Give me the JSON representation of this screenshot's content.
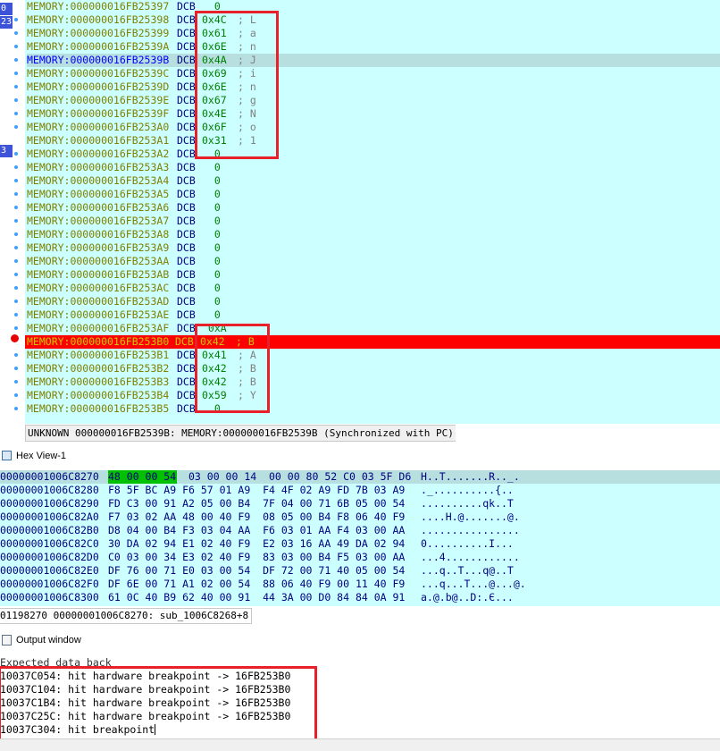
{
  "disassembly": {
    "gutter_tags": [
      "0",
      "23",
      "3"
    ],
    "rows": [
      {
        "addr": "MEMORY:000000016FB25397",
        "ins": "DCB",
        "val": "  0",
        "cmt": ""
      },
      {
        "addr": "MEMORY:000000016FB25398",
        "ins": "DCB",
        "val": "0x4C",
        "cmt": "; L"
      },
      {
        "addr": "MEMORY:000000016FB25399",
        "ins": "DCB",
        "val": "0x61",
        "cmt": "; a"
      },
      {
        "addr": "MEMORY:000000016FB2539A",
        "ins": "DCB",
        "val": "0x6E",
        "cmt": "; n"
      },
      {
        "addr": "MEMORY:000000016FB2539B",
        "ins": "DCB",
        "val": "0x4A",
        "cmt": "; J"
      },
      {
        "addr": "MEMORY:000000016FB2539C",
        "ins": "DCB",
        "val": "0x69",
        "cmt": "; i"
      },
      {
        "addr": "MEMORY:000000016FB2539D",
        "ins": "DCB",
        "val": "0x6E",
        "cmt": "; n"
      },
      {
        "addr": "MEMORY:000000016FB2539E",
        "ins": "DCB",
        "val": "0x67",
        "cmt": "; g"
      },
      {
        "addr": "MEMORY:000000016FB2539F",
        "ins": "DCB",
        "val": "0x4E",
        "cmt": "; N"
      },
      {
        "addr": "MEMORY:000000016FB253A0",
        "ins": "DCB",
        "val": "0x6F",
        "cmt": "; o"
      },
      {
        "addr": "MEMORY:000000016FB253A1",
        "ins": "DCB",
        "val": "0x31",
        "cmt": "; 1"
      },
      {
        "addr": "MEMORY:000000016FB253A2",
        "ins": "DCB",
        "val": "  0",
        "cmt": ""
      },
      {
        "addr": "MEMORY:000000016FB253A3",
        "ins": "DCB",
        "val": "  0",
        "cmt": ""
      },
      {
        "addr": "MEMORY:000000016FB253A4",
        "ins": "DCB",
        "val": "  0",
        "cmt": ""
      },
      {
        "addr": "MEMORY:000000016FB253A5",
        "ins": "DCB",
        "val": "  0",
        "cmt": ""
      },
      {
        "addr": "MEMORY:000000016FB253A6",
        "ins": "DCB",
        "val": "  0",
        "cmt": ""
      },
      {
        "addr": "MEMORY:000000016FB253A7",
        "ins": "DCB",
        "val": "  0",
        "cmt": ""
      },
      {
        "addr": "MEMORY:000000016FB253A8",
        "ins": "DCB",
        "val": "  0",
        "cmt": ""
      },
      {
        "addr": "MEMORY:000000016FB253A9",
        "ins": "DCB",
        "val": "  0",
        "cmt": ""
      },
      {
        "addr": "MEMORY:000000016FB253AA",
        "ins": "DCB",
        "val": "  0",
        "cmt": ""
      },
      {
        "addr": "MEMORY:000000016FB253AB",
        "ins": "DCB",
        "val": "  0",
        "cmt": ""
      },
      {
        "addr": "MEMORY:000000016FB253AC",
        "ins": "DCB",
        "val": "  0",
        "cmt": ""
      },
      {
        "addr": "MEMORY:000000016FB253AD",
        "ins": "DCB",
        "val": "  0",
        "cmt": ""
      },
      {
        "addr": "MEMORY:000000016FB253AE",
        "ins": "DCB",
        "val": "  0",
        "cmt": ""
      },
      {
        "addr": "MEMORY:000000016FB253AF",
        "ins": "DCB",
        "val": " 0xA",
        "cmt": ""
      },
      {
        "addr": "MEMORY:000000016FB253B0",
        "ins": "DCB",
        "val": "0x42",
        "cmt": "; B"
      },
      {
        "addr": "MEMORY:000000016FB253B1",
        "ins": "DCB",
        "val": "0x41",
        "cmt": "; A"
      },
      {
        "addr": "MEMORY:000000016FB253B2",
        "ins": "DCB",
        "val": "0x42",
        "cmt": "; B"
      },
      {
        "addr": "MEMORY:000000016FB253B3",
        "ins": "DCB",
        "val": "0x42",
        "cmt": "; B"
      },
      {
        "addr": "MEMORY:000000016FB253B4",
        "ins": "DCB",
        "val": "0x59",
        "cmt": "; Y"
      },
      {
        "addr": "MEMORY:000000016FB253B5",
        "ins": "DCB",
        "val": "  0",
        "cmt": ""
      }
    ],
    "status": "UNKNOWN 000000016FB2539B: MEMORY:000000016FB2539B (Synchronized with PC)"
  },
  "hex_view": {
    "title": "Hex View-1",
    "rows": [
      {
        "addr": "00000001006C8270",
        "bytes": "48 00 00 54  03 00 00 14  00 00 80 52 C0 03 5F D6",
        "ascii": "H..T.......R.._."
      },
      {
        "addr": "00000001006C8280",
        "bytes": "F8 5F BC A9 F6 57 01 A9  F4 4F 02 A9 FD 7B 03 A9",
        "ascii": "._..........{.."
      },
      {
        "addr": "00000001006C8290",
        "bytes": "FD C3 00 91 A2 05 00 B4  7F 04 00 71 6B 05 00 54",
        "ascii": "..........qk..T"
      },
      {
        "addr": "00000001006C82A0",
        "bytes": "F7 03 02 AA 48 00 40 F9  08 05 00 B4 F8 06 40 F9",
        "ascii": "....H.@.......@."
      },
      {
        "addr": "00000001006C82B0",
        "bytes": "D8 04 00 B4 F3 03 04 AA  F6 03 01 AA F4 03 00 AA",
        "ascii": "................"
      },
      {
        "addr": "00000001006C82C0",
        "bytes": "30 DA 02 94 E1 02 40 F9  E2 03 16 AA 49 DA 02 94",
        "ascii": "0..........I..."
      },
      {
        "addr": "00000001006C82D0",
        "bytes": "C0 03 00 34 E3 02 40 F9  83 03 00 B4 F5 03 00 AA",
        "ascii": "...4............"
      },
      {
        "addr": "00000001006C82E0",
        "bytes": "DF 76 00 71 E0 03 00 54  DF 72 00 71 40 05 00 54",
        "ascii": "...q..T...q@..T"
      },
      {
        "addr": "00000001006C82F0",
        "bytes": "DF 6E 00 71 A1 02 00 54  88 06 40 F9 00 11 40 F9",
        "ascii": "...q...T...@...@."
      },
      {
        "addr": "00000001006C8300",
        "bytes": "61 0C 40 B9 62 40 00 91  44 3A 00 D0 84 84 0A 91",
        "ascii": "a.@.b@..D:.Є..."
      }
    ],
    "status": "01198270 00000001006C8270: sub_1006C8268+8"
  },
  "output_window": {
    "title": "Output window",
    "lines": [
      "Expected data back",
      "10037C054: hit hardware breakpoint -> 16FB253B0",
      "10037C104: hit hardware breakpoint -> 16FB253B0",
      "10037C1B4: hit hardware breakpoint -> 16FB253B0",
      "10037C25C: hit hardware breakpoint -> 16FB253B0",
      "10037C304: hit breakpoint"
    ]
  },
  "colors": {
    "view_bg": "#ccffff",
    "breakpoint_line": "#ff0000",
    "annotation_box": "#e8202a",
    "hex_selection": "#00c000"
  }
}
